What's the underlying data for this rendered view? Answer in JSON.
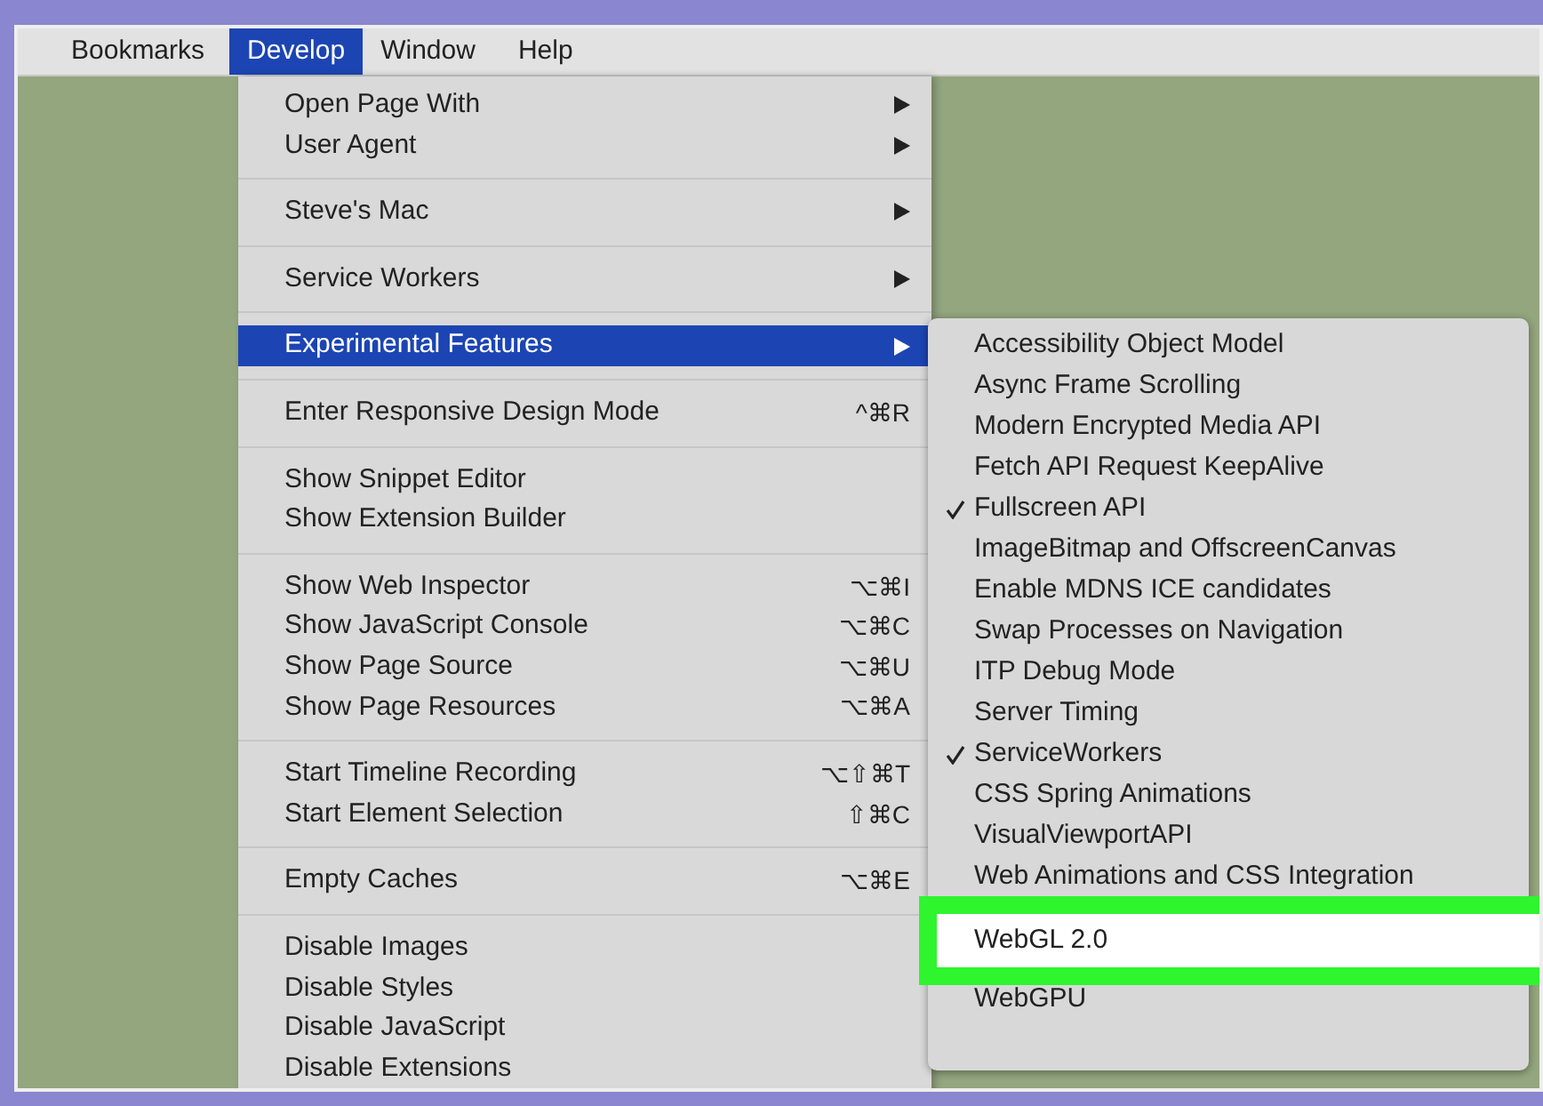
{
  "menu_bar": [
    {
      "label": "Bookmarks",
      "selected": false
    },
    {
      "label": "Develop",
      "selected": true
    },
    {
      "label": "Window",
      "selected": false
    },
    {
      "label": "Help",
      "selected": false
    }
  ],
  "develop_menu": [
    {
      "kind": "item",
      "label": "Open Page With",
      "submenu": true,
      "selected": false
    },
    {
      "kind": "item",
      "label": "User Agent",
      "submenu": true,
      "selected": false
    },
    {
      "kind": "separator"
    },
    {
      "kind": "item",
      "label": "Steve's Mac",
      "submenu": true,
      "selected": false
    },
    {
      "kind": "separator"
    },
    {
      "kind": "item",
      "label": "Service Workers",
      "submenu": true,
      "selected": false
    },
    {
      "kind": "separator"
    },
    {
      "kind": "item",
      "label": "Experimental Features",
      "submenu": true,
      "selected": true
    },
    {
      "kind": "separator"
    },
    {
      "kind": "item",
      "label": "Enter Responsive Design Mode",
      "shortcut": "^⌘R",
      "selected": false
    },
    {
      "kind": "separator"
    },
    {
      "kind": "item",
      "label": "Show Snippet Editor",
      "selected": false
    },
    {
      "kind": "item",
      "label": "Show Extension Builder",
      "selected": false
    },
    {
      "kind": "separator"
    },
    {
      "kind": "item",
      "label": "Show Web Inspector",
      "shortcut": "⌥⌘I",
      "selected": false
    },
    {
      "kind": "item",
      "label": "Show JavaScript Console",
      "shortcut": "⌥⌘C",
      "selected": false
    },
    {
      "kind": "item",
      "label": "Show Page Source",
      "shortcut": "⌥⌘U",
      "selected": false
    },
    {
      "kind": "item",
      "label": "Show Page Resources",
      "shortcut": "⌥⌘A",
      "selected": false
    },
    {
      "kind": "separator"
    },
    {
      "kind": "item",
      "label": "Start Timeline Recording",
      "shortcut": "⌥⇧⌘T",
      "selected": false
    },
    {
      "kind": "item",
      "label": "Start Element Selection",
      "shortcut": "⇧⌘C",
      "selected": false
    },
    {
      "kind": "separator"
    },
    {
      "kind": "item",
      "label": "Empty Caches",
      "shortcut": "⌥⌘E",
      "selected": false
    },
    {
      "kind": "separator"
    },
    {
      "kind": "item",
      "label": "Disable Images",
      "selected": false
    },
    {
      "kind": "item",
      "label": "Disable Styles",
      "selected": false
    },
    {
      "kind": "item",
      "label": "Disable JavaScript",
      "selected": false
    },
    {
      "kind": "item",
      "label": "Disable Extensions",
      "selected": false
    }
  ],
  "experimental_features_menu": [
    {
      "label": "Accessibility Object Model",
      "checked": false,
      "highlighted": false
    },
    {
      "label": "Async Frame Scrolling",
      "checked": false,
      "highlighted": false
    },
    {
      "label": "Modern Encrypted Media API",
      "checked": false,
      "highlighted": false
    },
    {
      "label": "Fetch API Request KeepAlive",
      "checked": false,
      "highlighted": false
    },
    {
      "label": "Fullscreen API",
      "checked": true,
      "highlighted": false
    },
    {
      "label": "ImageBitmap and OffscreenCanvas",
      "checked": false,
      "highlighted": false
    },
    {
      "label": "Enable MDNS ICE candidates",
      "checked": false,
      "highlighted": false
    },
    {
      "label": "Swap Processes on Navigation",
      "checked": false,
      "highlighted": false
    },
    {
      "label": "ITP Debug Mode",
      "checked": false,
      "highlighted": false
    },
    {
      "label": "Server Timing",
      "checked": false,
      "highlighted": false
    },
    {
      "label": "ServiceWorkers",
      "checked": true,
      "highlighted": false
    },
    {
      "label": "CSS Spring Animations",
      "checked": false,
      "highlighted": false
    },
    {
      "label": "VisualViewportAPI",
      "checked": false,
      "highlighted": false
    },
    {
      "label": "Web Animations and CSS Integration",
      "checked": false,
      "highlighted": false
    },
    {
      "label": "WebGL 2.0",
      "checked": false,
      "highlighted": true
    },
    {
      "label": "WebGPU",
      "checked": false,
      "highlighted": false
    }
  ]
}
